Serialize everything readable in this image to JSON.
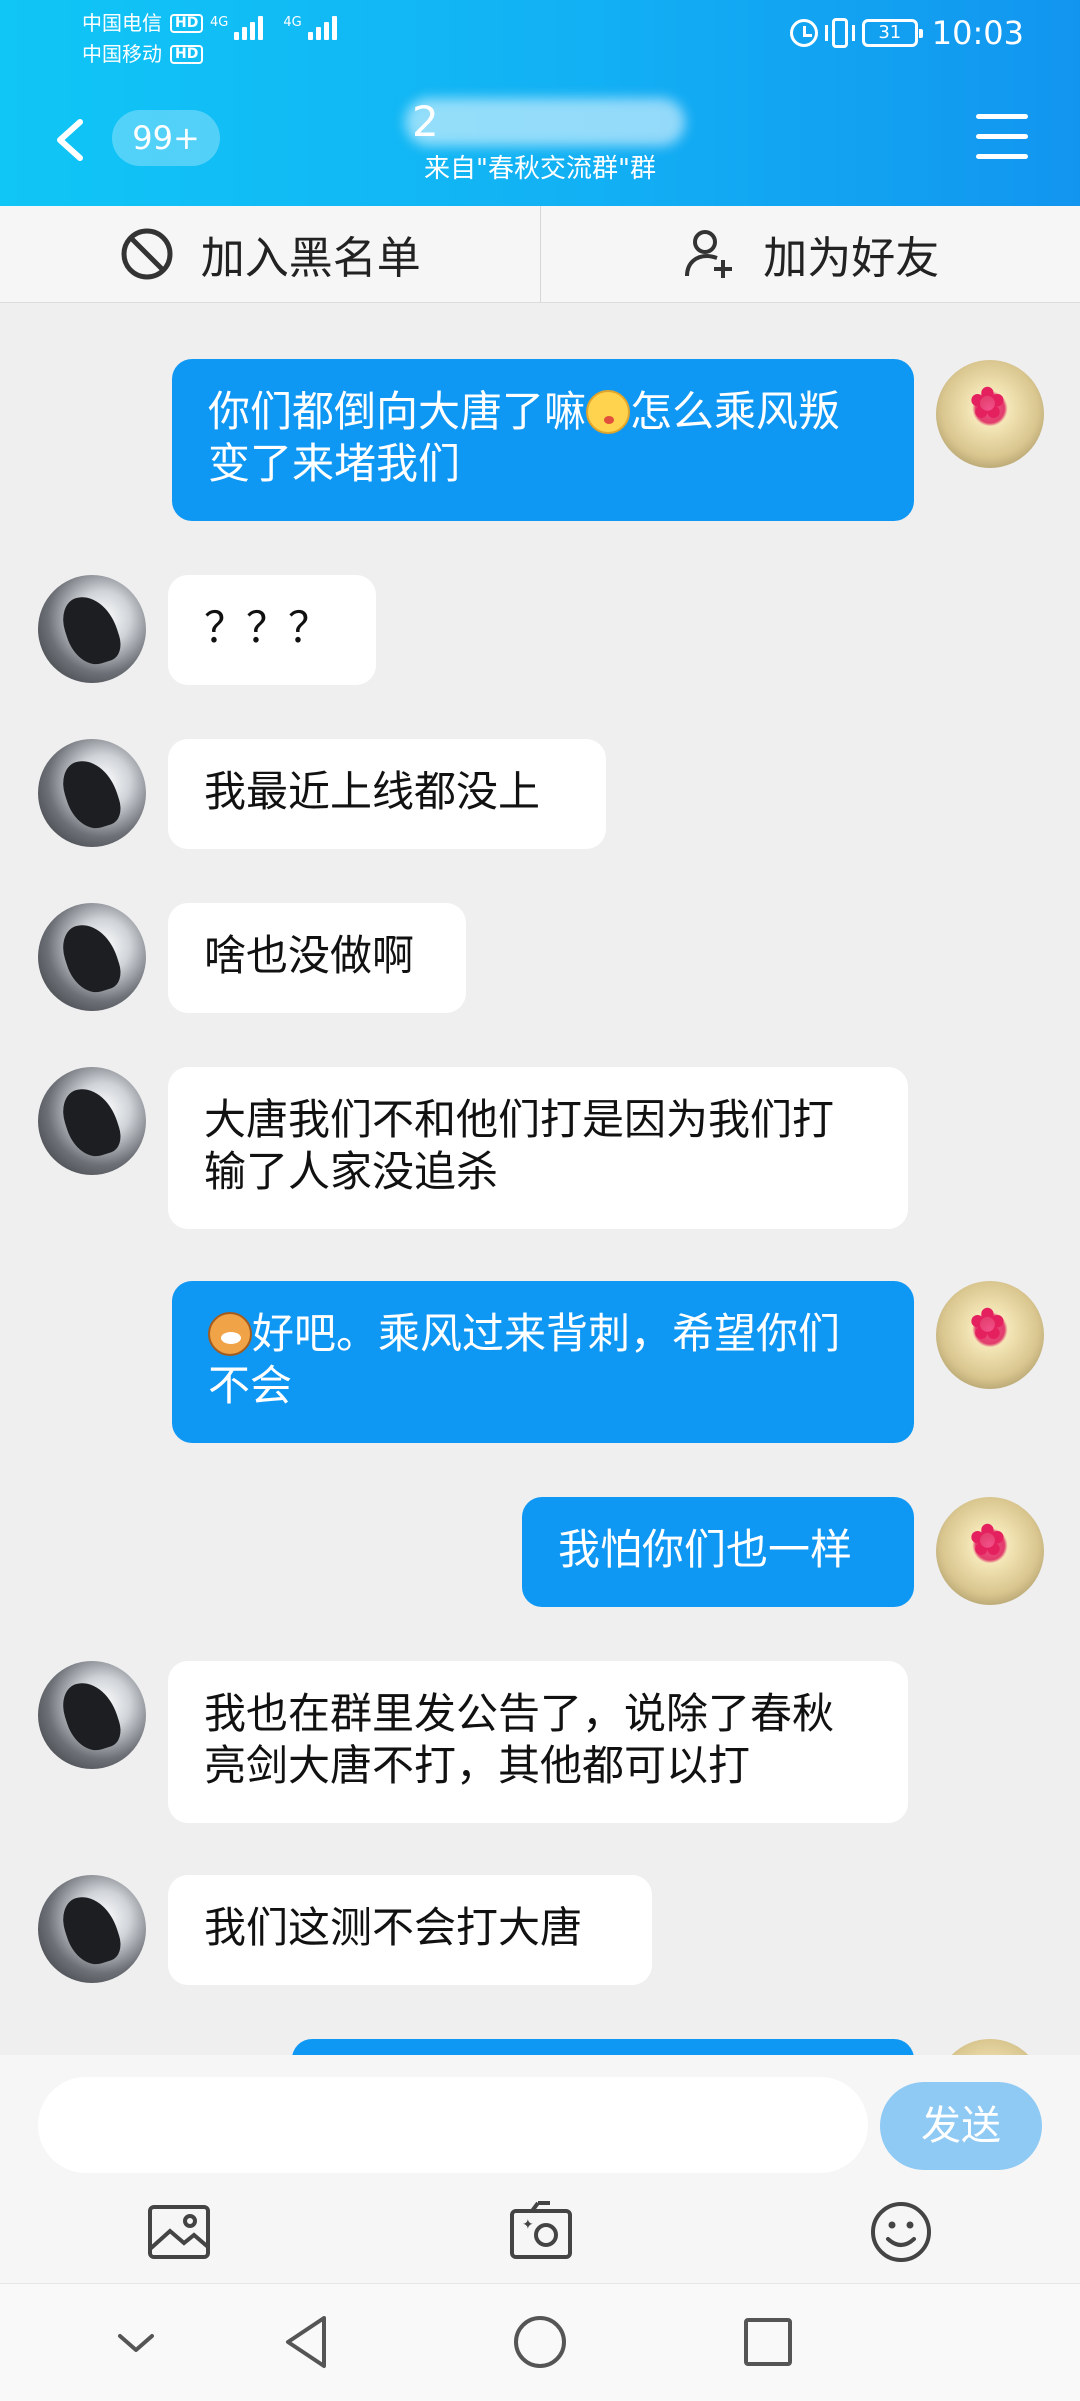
{
  "status_bar": {
    "carrier1": "中国电信",
    "carrier2": "中国移动",
    "hd": "HD",
    "network": "4G",
    "battery": "31",
    "time": "10:03"
  },
  "header": {
    "back_badge": "99+",
    "title_visible": "2",
    "subtitle": "来自\"春秋交流群\"群"
  },
  "actions": {
    "blacklist": "加入黑名单",
    "add_friend": "加为好友"
  },
  "messages": [
    {
      "side": "out",
      "text_before": "你们都倒向大唐了嘛",
      "emoji": "kiss-emoji",
      "text_after": "怎么乘风叛变了来堵我们"
    },
    {
      "side": "in",
      "text": "？？？"
    },
    {
      "side": "in",
      "text": "我最近上线都没上"
    },
    {
      "side": "in",
      "text": "啥也没做啊"
    },
    {
      "side": "in",
      "text": "大唐我们不和他们打是因为我们打输了人家没追杀"
    },
    {
      "side": "out",
      "emoji": "dog-emoji",
      "text_after": "好吧。乘风过来背刺，希望你们不会"
    },
    {
      "side": "out",
      "text": "我怕你们也一样"
    },
    {
      "side": "in",
      "text": "我也在群里发公告了，说除了春秋亮剑大唐不打，其他都可以打"
    },
    {
      "side": "in",
      "text": "我们这测不会打大唐"
    }
  ],
  "input": {
    "placeholder": "",
    "send": "发送"
  },
  "icons": {
    "back": "chevron-left-icon",
    "menu": "hamburger-menu-icon",
    "blacklist": "block-icon",
    "add_friend": "add-user-icon",
    "image": "image-icon",
    "camera": "camera-icon",
    "emoji": "smiley-icon"
  },
  "colors": {
    "header": "#12b0f4",
    "outgoing_bubble": "#0f97f4",
    "incoming_bubble": "#ffffff",
    "send_button": "#8fcaf5"
  }
}
